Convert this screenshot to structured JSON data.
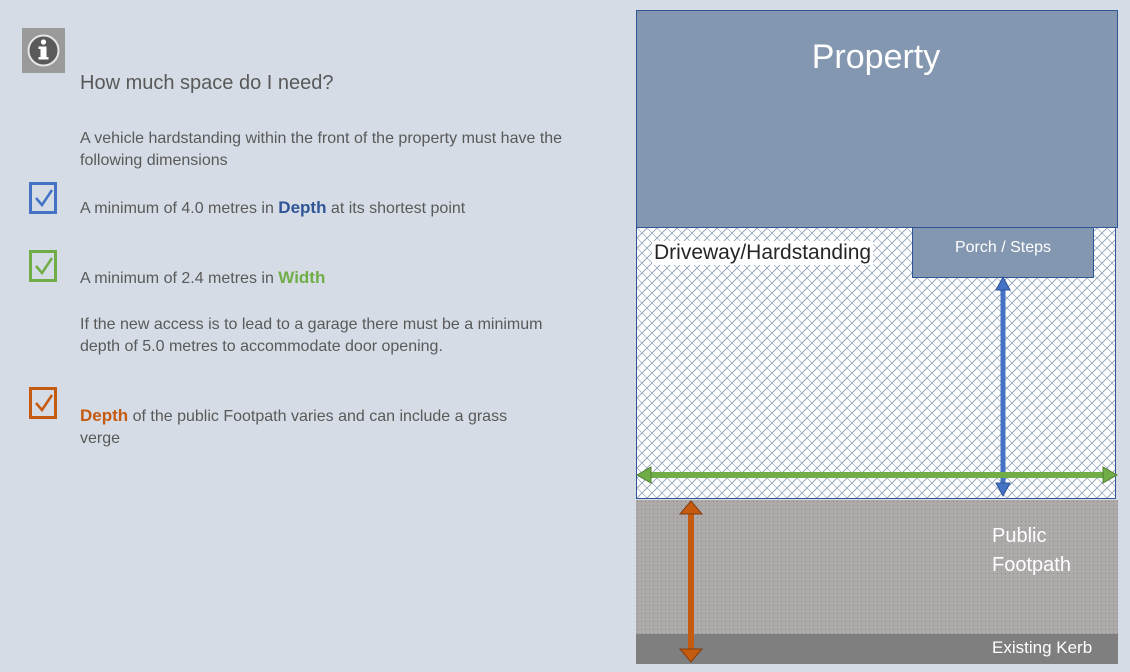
{
  "info": {
    "icon": "info-icon",
    "heading": "How much space do I need?",
    "intro": "A vehicle hardstanding within the front of the property must have the following dimensions"
  },
  "items": [
    {
      "icon": "checkbox-checked-icon",
      "color": "#4472c4",
      "prefix": "A minimum of 4.0 metres in",
      "keyword": "Depth",
      "suffix": "at its shortest point"
    },
    {
      "icon": "checkbox-checked-icon",
      "color": "#70ad47",
      "prefix": "A minimum of 2.4 metres in",
      "keyword": "Width",
      "suffix": ""
    },
    {
      "icon": "checkbox-checked-icon",
      "color": "#c55a11",
      "prefix": "",
      "keyword": "Depth",
      "suffix": "of the public Footpath varies and can include a grass",
      "suffix2": "verge"
    }
  ],
  "garage_note": "If the new access is to lead to a garage there must be a minimum depth of 5.0 metres to accommodate door opening.",
  "diagram": {
    "property": "Property",
    "driveway": "Driveway/Hardstanding",
    "porch": "Porch / Steps",
    "footpath_line1": "Public",
    "footpath_line2": "Footpath",
    "kerb": "Existing Kerb",
    "colors": {
      "depth": "#4472c4",
      "width": "#70ad47",
      "footpath_depth": "#c55a11"
    }
  }
}
